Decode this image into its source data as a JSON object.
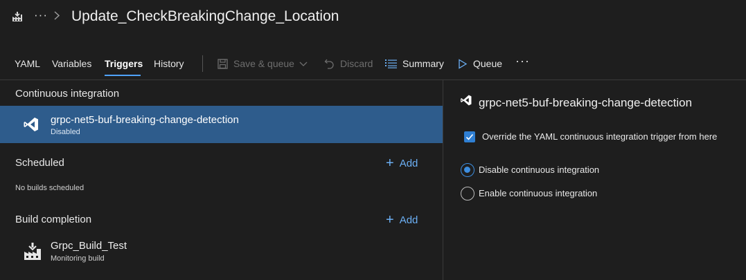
{
  "header": {
    "icon": "pipeline-factory-icon",
    "more": "···",
    "title": "Update_CheckBreakingChange_Location"
  },
  "toolbar": {
    "tabs": [
      {
        "label": "YAML"
      },
      {
        "label": "Variables"
      },
      {
        "label": "Triggers"
      },
      {
        "label": "History"
      }
    ],
    "active_tab": "Triggers",
    "save_queue": "Save & queue",
    "discard": "Discard",
    "summary": "Summary",
    "queue": "Queue",
    "more": "···"
  },
  "left": {
    "ci_title": "Continuous integration",
    "ci_item": {
      "name": "grpc-net5-buf-breaking-change-detection",
      "status": "Disabled",
      "icon": "visual-studio-icon"
    },
    "scheduled_title": "Scheduled",
    "scheduled_add": "Add",
    "scheduled_empty": "No builds scheduled",
    "build_completion_title": "Build completion",
    "build_completion_add": "Add",
    "build_completion_item": {
      "name": "Grpc_Build_Test",
      "status": "Monitoring build",
      "icon": "build-pipeline-icon"
    }
  },
  "right": {
    "title": "grpc-net5-buf-breaking-change-detection",
    "override_label": "Override the YAML continuous integration trigger from here",
    "override_checked": true,
    "radio_disable": "Disable continuous integration",
    "radio_enable": "Enable continuous integration",
    "selected_radio": "disable"
  },
  "colors": {
    "background": "#1e1e1e",
    "selected_row": "#2e5c8c",
    "accent": "#4fa3ff",
    "link": "#6cb0f5"
  }
}
